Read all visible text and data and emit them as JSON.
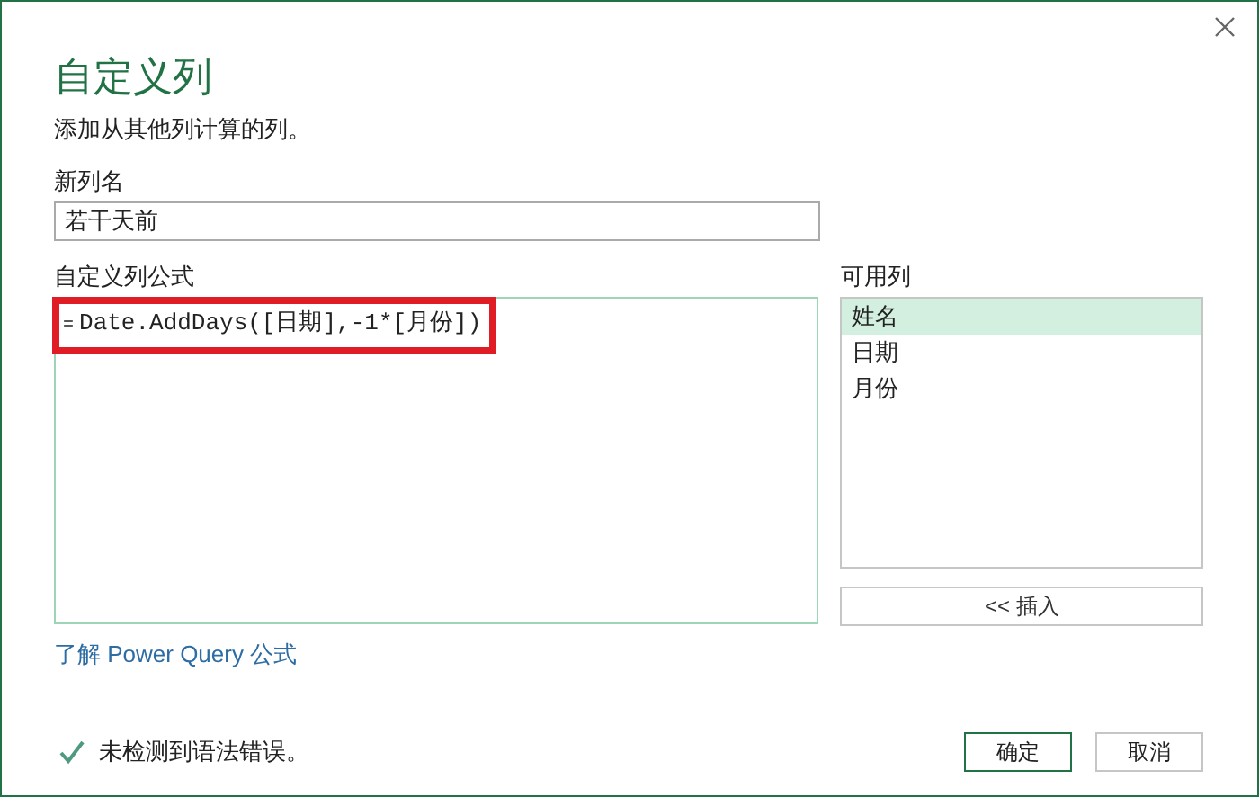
{
  "dialog": {
    "title": "自定义列",
    "subtitle": "添加从其他列计算的列。"
  },
  "new_column_name": {
    "label": "新列名",
    "value": "若干天前"
  },
  "formula": {
    "label": "自定义列公式",
    "prefix": "=",
    "value": "Date.AddDays([日期],-1*[月份])",
    "highlighted": true
  },
  "available_columns": {
    "label": "可用列",
    "items": [
      {
        "label": "姓名",
        "selected": true
      },
      {
        "label": "日期",
        "selected": false
      },
      {
        "label": "月份",
        "selected": false
      }
    ],
    "insert_button": "<< 插入"
  },
  "help_link": "了解 Power Query 公式",
  "status": {
    "ok": true,
    "message": "未检测到语法错误。"
  },
  "buttons": [
    {
      "label": "确定",
      "kind": "primary"
    },
    {
      "label": "取消",
      "kind": "secondary"
    }
  ]
}
